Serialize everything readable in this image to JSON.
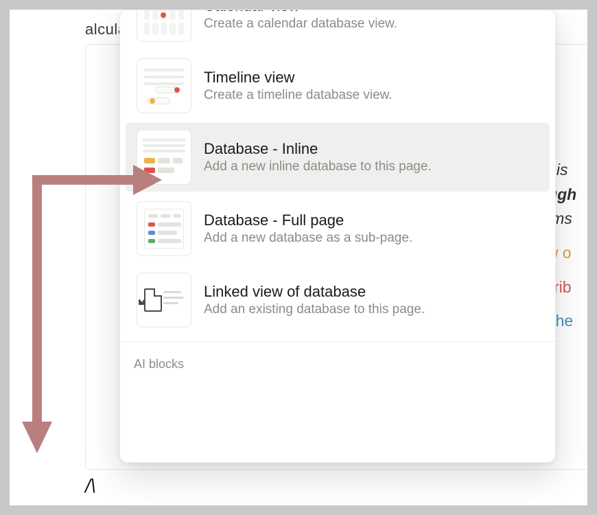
{
  "page": {
    "faint_word": "alculate",
    "cursor": "/\\"
  },
  "peek": {
    "l1": "This ",
    "l2": "ough",
    "l3": "thms",
    "l4": "ow o",
    "l5": "scrib",
    "l6": "d the"
  },
  "menu": {
    "items": [
      {
        "title": "Calendar view",
        "desc": "Create a calendar database view."
      },
      {
        "title": "Timeline view",
        "desc": "Create a timeline database view."
      },
      {
        "title": "Database - Inline",
        "desc": "Add a new inline database to this page."
      },
      {
        "title": "Database - Full page",
        "desc": "Add a new database as a sub-page."
      },
      {
        "title": "Linked view of database",
        "desc": "Add an existing database to this page."
      }
    ],
    "section_label": "AI blocks"
  }
}
